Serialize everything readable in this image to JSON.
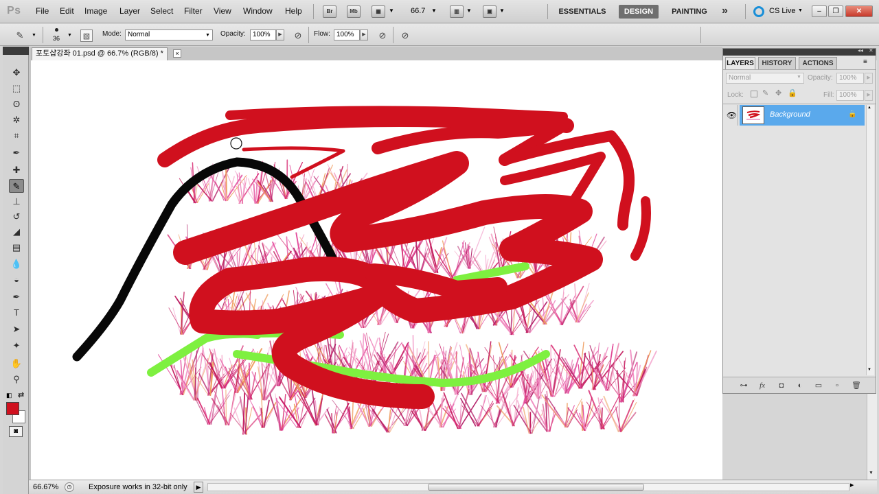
{
  "app": {
    "logo": "Ps",
    "menu": [
      "File",
      "Edit",
      "Image",
      "Layer",
      "Select",
      "Filter",
      "View",
      "Window",
      "Help"
    ],
    "bridge_icon": "Br",
    "minibridge_icon": "Mb",
    "zoom_value": "66.7",
    "workspaces": [
      "ESSENTIALS",
      "DESIGN",
      "PAINTING"
    ],
    "active_workspace": "DESIGN",
    "more_workspaces": "»",
    "cs_live": "CS Live",
    "window_controls": {
      "minimize": "–",
      "restore": "❐",
      "close": "✕"
    }
  },
  "options_bar": {
    "brush_size": "36",
    "mode_label": "Mode:",
    "mode_value": "Normal",
    "opacity_label": "Opacity:",
    "opacity_value": "100%",
    "flow_label": "Flow:",
    "flow_value": "100%"
  },
  "tools": [
    {
      "name": "move-tool",
      "glyph": "✥"
    },
    {
      "name": "marquee-tool",
      "glyph": "⬚"
    },
    {
      "name": "lasso-tool",
      "glyph": "ʘ"
    },
    {
      "name": "quick-selection-tool",
      "glyph": "✲"
    },
    {
      "name": "crop-tool",
      "glyph": "⌗"
    },
    {
      "name": "eyedropper-tool",
      "glyph": "✒"
    },
    {
      "name": "spot-healing-tool",
      "glyph": "✚"
    },
    {
      "name": "brush-tool",
      "glyph": "✎"
    },
    {
      "name": "clone-stamp-tool",
      "glyph": "⊥"
    },
    {
      "name": "history-brush-tool",
      "glyph": "↺"
    },
    {
      "name": "eraser-tool",
      "glyph": "◢"
    },
    {
      "name": "gradient-tool",
      "glyph": "▤"
    },
    {
      "name": "blur-tool",
      "glyph": "💧"
    },
    {
      "name": "dodge-tool",
      "glyph": "◒"
    },
    {
      "name": "pen-tool",
      "glyph": "✒"
    },
    {
      "name": "type-tool",
      "glyph": "T"
    },
    {
      "name": "path-selection-tool",
      "glyph": "➤"
    },
    {
      "name": "shape-tool",
      "glyph": "✦"
    },
    {
      "name": "hand-tool",
      "glyph": "✋"
    },
    {
      "name": "zoom-tool",
      "glyph": "⚲"
    }
  ],
  "selected_tool": "brush-tool",
  "colors": {
    "foreground": "#d0101e",
    "background": "#ffffff",
    "stroke_red": "#d0101e",
    "stroke_black": "#080808",
    "stroke_green": "#7ef040",
    "layer_selection": "#5aa9ec"
  },
  "document": {
    "tab_title": "포토샵강좌 01.psd @ 66.7% (RGB/8) *"
  },
  "status_bar": {
    "zoom": "66.67%",
    "info": "Exposure works in 32-bit only"
  },
  "layers_panel": {
    "tabs": [
      "LAYERS",
      "HISTORY",
      "ACTIONS"
    ],
    "active_tab": "LAYERS",
    "blend_mode": "Normal",
    "opacity_label": "Opacity:",
    "opacity_value": "100%",
    "lock_label": "Lock:",
    "fill_label": "Fill:",
    "fill_value": "100%",
    "layers": [
      {
        "name": "Background",
        "visible": true,
        "locked": true
      }
    ],
    "bottom_icons": [
      "link-layers-icon",
      "fx-icon",
      "add-mask-icon",
      "adjustment-layer-icon",
      "new-group-icon",
      "new-layer-icon",
      "trash-icon"
    ]
  }
}
